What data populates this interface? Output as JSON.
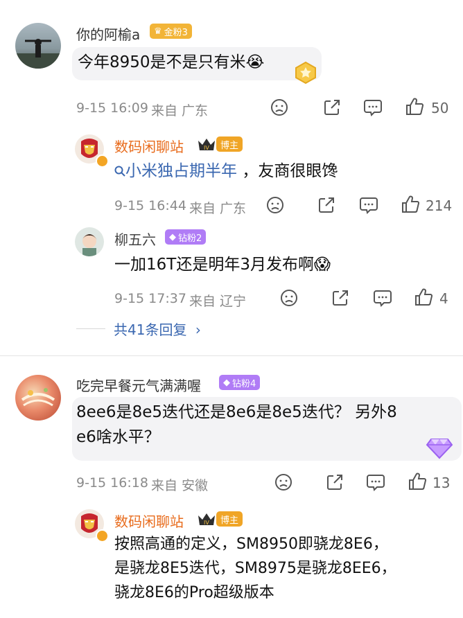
{
  "comments": [
    {
      "user": "你的阿榆a",
      "badge": "金粉3",
      "text": "今年8950是不是只有米😭",
      "meta_time": "9-15 16:09",
      "meta_from": "来自 广东",
      "likes": "50"
    },
    {
      "user": "数码闲聊站",
      "badge": "博主",
      "text_tag": "小米独占期半年",
      "text_rest": "，友商很眼馋",
      "meta_time": "9-15 16:44",
      "meta_from": "来自 广东",
      "likes": "214"
    },
    {
      "user": "柳五六",
      "badge": "钻粉2",
      "text": "一加16T还是明年3月发布啊😱",
      "meta_time": "9-15 17:37",
      "meta_from": "来自 辽宁",
      "likes": "4"
    },
    {
      "more_replies": "共41条回复"
    },
    {
      "user": "吃完早餐元气满满喔",
      "badge": "钻粉4",
      "text_line1": "8ee6是8e5迭代还是8e6是8e5迭代？ 另外8",
      "text_line2": "e6啥水平？",
      "meta_time": "9-15 16:18",
      "meta_from": "来自 安徽",
      "likes": "13"
    },
    {
      "user": "数码闲聊站",
      "badge": "博主",
      "text_line1": "按照高通的定义，SM8950即骁龙8E6，",
      "text_line2": "是骁龙8E5迭代，SM8975是骁龙8EE6，",
      "text_line3": "骁龙8E6的Pro超级版本"
    }
  ],
  "icons": [
    "dislike-icon",
    "share-icon",
    "comment-icon",
    "like-icon",
    "chevron-right-icon",
    "search-tag-icon",
    "gem-icon",
    "crown-icon"
  ]
}
